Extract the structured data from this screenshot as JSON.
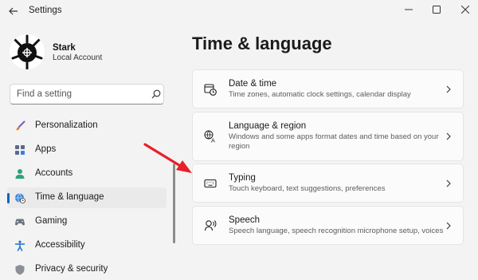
{
  "window": {
    "title": "Settings",
    "controls": [
      "minimize",
      "maximize",
      "close"
    ]
  },
  "user": {
    "name": "Stark",
    "account_type": "Local Account"
  },
  "search": {
    "placeholder": "Find a setting"
  },
  "sidebar": {
    "items": [
      {
        "label": "Personalization",
        "icon": "brush-icon",
        "active": false
      },
      {
        "label": "Apps",
        "icon": "apps-icon",
        "active": false
      },
      {
        "label": "Accounts",
        "icon": "person-icon",
        "active": false
      },
      {
        "label": "Time & language",
        "icon": "globe-clock-icon",
        "active": true
      },
      {
        "label": "Gaming",
        "icon": "gamepad-icon",
        "active": false
      },
      {
        "label": "Accessibility",
        "icon": "accessibility-icon",
        "active": false
      },
      {
        "label": "Privacy & security",
        "icon": "shield-icon",
        "active": false
      }
    ]
  },
  "main": {
    "title": "Time & language",
    "cards": [
      {
        "title": "Date & time",
        "description": "Time zones, automatic clock settings, calendar display",
        "icon": "calendar-clock-icon"
      },
      {
        "title": "Language & region",
        "description": "Windows and some apps format dates and time based on your region",
        "icon": "language-icon"
      },
      {
        "title": "Typing",
        "description": "Touch keyboard, text suggestions, preferences",
        "icon": "keyboard-icon"
      },
      {
        "title": "Speech",
        "description": "Speech language, speech recognition microphone setup, voices",
        "icon": "speech-icon"
      }
    ]
  },
  "colors": {
    "accent": "#0067c0",
    "annotation_arrow": "#e8202a",
    "background": "#f3f3f3",
    "card": "#fbfbfb"
  }
}
